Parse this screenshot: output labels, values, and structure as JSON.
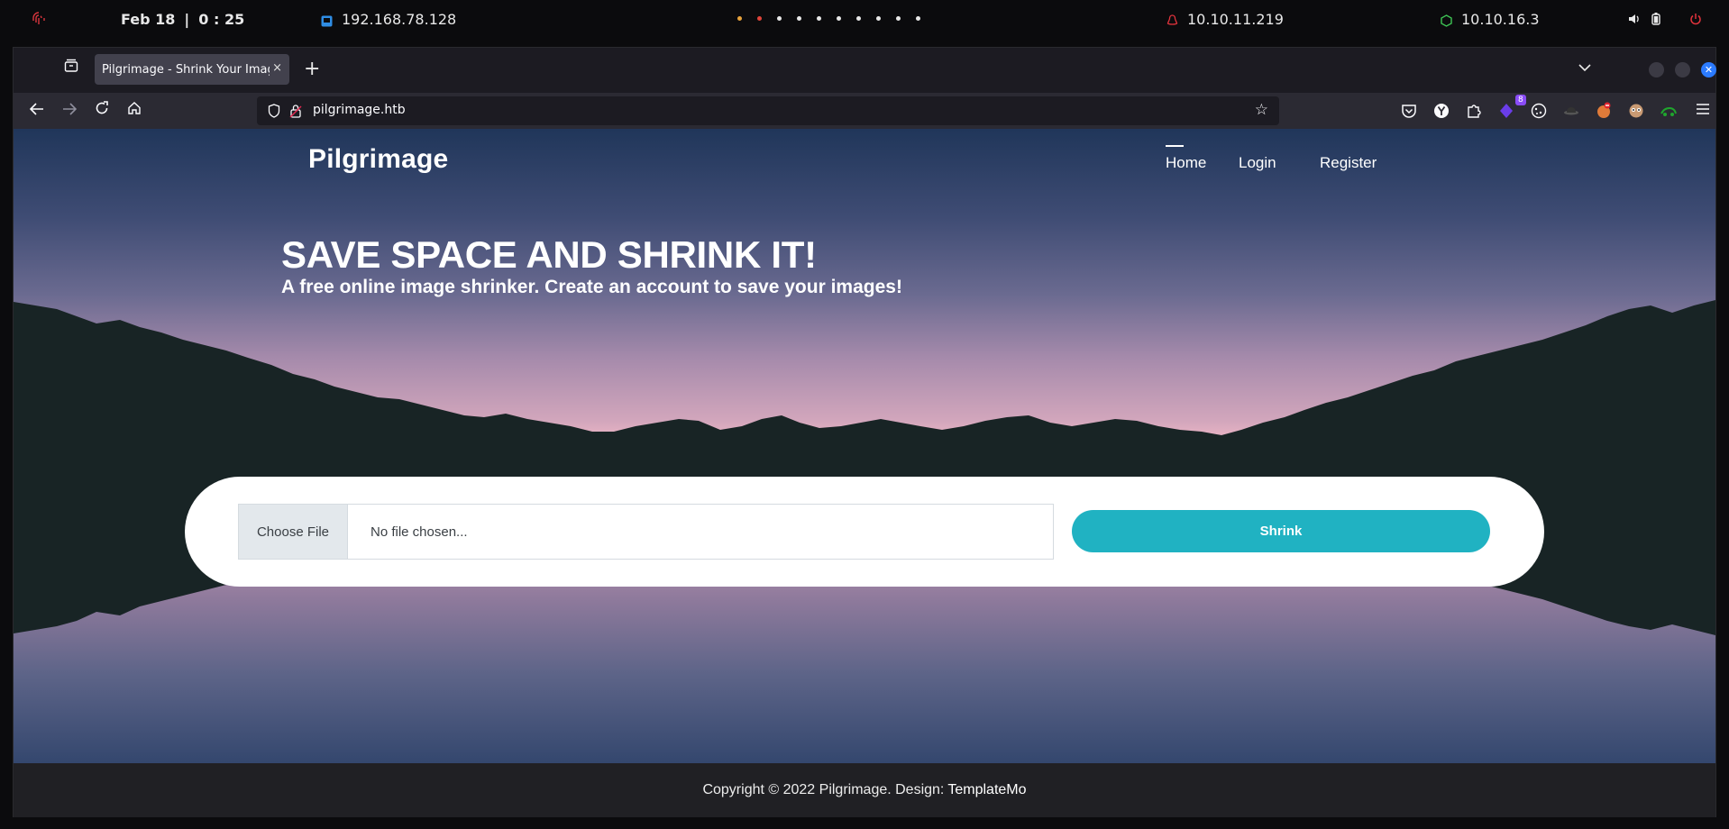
{
  "system_bar": {
    "date": "Feb 18",
    "separator": "|",
    "time": "0 : 25",
    "vm_ip": "192.168.78.128",
    "target_ip": "10.10.11.219",
    "vpn_ip": "10.10.16.3"
  },
  "browser": {
    "tab_title": "Pilgrimage - Shrink Your Images",
    "tab_close": "×",
    "new_tab": "+",
    "url": "pilgrimage.htb",
    "extension_badge": "8"
  },
  "site": {
    "brand": "Pilgrimage",
    "nav": [
      {
        "label": "Home",
        "active": true
      },
      {
        "label": "Login",
        "active": false
      },
      {
        "label": "Register",
        "active": false
      }
    ],
    "hero_title": "SAVE SPACE AND SHRINK IT!",
    "hero_subtitle": "A free online image shrinker. Create an account to save your images!",
    "upload": {
      "choose_label": "Choose File",
      "file_placeholder": "No file chosen...",
      "submit_label": "Shrink"
    },
    "footer": {
      "text": "Copyright © 2022 Pilgrimage. Design:",
      "credit": "TemplateMo"
    }
  },
  "colors": {
    "accent": "#20b2c2",
    "footer_bg": "#202024",
    "browser_chrome": "#2b2a33"
  }
}
